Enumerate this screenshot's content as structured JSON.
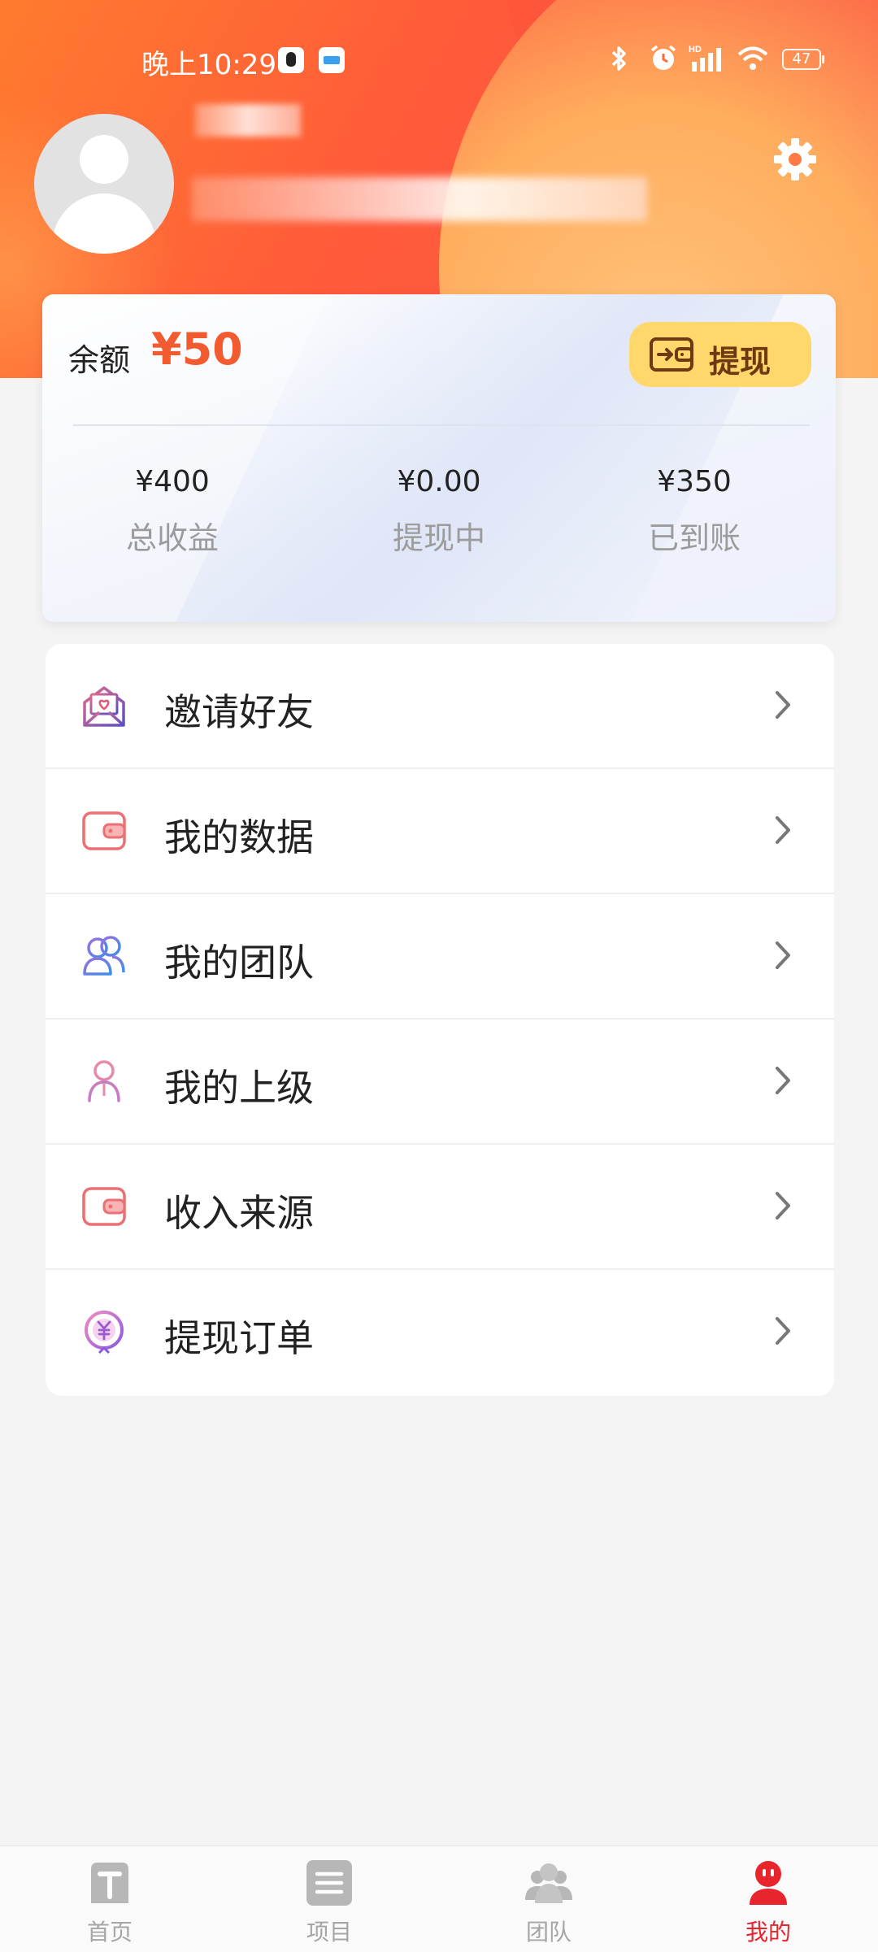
{
  "status_bar": {
    "time": "晚上10:29",
    "battery": "47"
  },
  "profile": {
    "settings_icon": "gear-icon"
  },
  "balance_card": {
    "balance_label": "余额",
    "balance_value": "¥50",
    "withdraw_label": "提现",
    "stats": [
      {
        "value": "¥400",
        "label": "总收益"
      },
      {
        "value": "¥0.00",
        "label": "提现中"
      },
      {
        "value": "¥350",
        "label": "已到账"
      }
    ],
    "accent_color": "#f25a2f",
    "button_color": "#ffd76a"
  },
  "menu": {
    "items": [
      {
        "label": "邀请好友",
        "icon": "invite-envelope-icon"
      },
      {
        "label": "我的数据",
        "icon": "wallet-icon"
      },
      {
        "label": "我的团队",
        "icon": "team-icon"
      },
      {
        "label": "我的上级",
        "icon": "person-icon"
      },
      {
        "label": "收入来源",
        "icon": "wallet-icon"
      },
      {
        "label": "提现订单",
        "icon": "yuan-coin-icon"
      }
    ]
  },
  "tabbar": {
    "tabs": [
      {
        "label": "首页",
        "icon": "home-t-icon"
      },
      {
        "label": "项目",
        "icon": "list-icon"
      },
      {
        "label": "团队",
        "icon": "group-icon"
      },
      {
        "label": "我的",
        "icon": "profile-face-icon"
      }
    ],
    "active_color": "#e8242c"
  }
}
